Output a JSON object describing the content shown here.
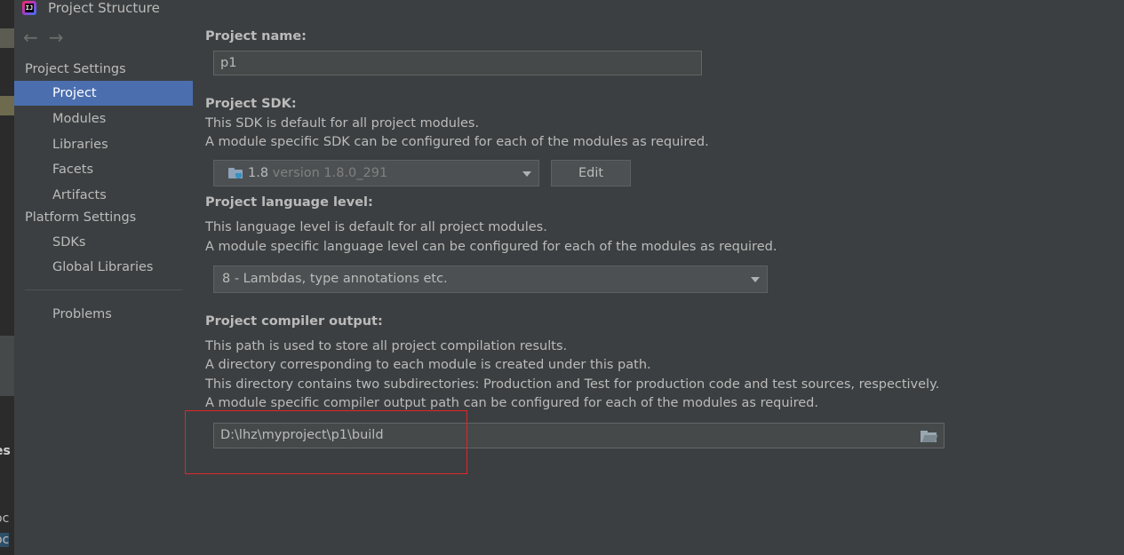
{
  "window": {
    "title": "Project Structure"
  },
  "background_fragments": [
    "es",
    "oc",
    "oc"
  ],
  "navigation": {
    "back": "←",
    "forward": "→"
  },
  "sidebar": {
    "project_settings_header": "Project Settings",
    "project_settings_items": [
      {
        "label": "Project",
        "selected": true
      },
      {
        "label": "Modules"
      },
      {
        "label": "Libraries"
      },
      {
        "label": "Facets"
      },
      {
        "label": "Artifacts"
      }
    ],
    "platform_settings_header": "Platform Settings",
    "platform_settings_items": [
      {
        "label": "SDKs"
      },
      {
        "label": "Global Libraries"
      }
    ],
    "problems_label": "Problems"
  },
  "project_name": {
    "label": "Project name:",
    "value": "p1"
  },
  "project_sdk": {
    "label": "Project SDK:",
    "desc_line1": "This SDK is default for all project modules.",
    "desc_line2": "A module specific SDK can be configured for each of the modules as required.",
    "selected_name": "1.8",
    "selected_version": "version 1.8.0_291",
    "edit_label": "Edit"
  },
  "language_level": {
    "label": "Project language level:",
    "desc_line1": "This language level is default for all project modules.",
    "desc_line2": "A module specific language level can be configured for each of the modules as required.",
    "selected": "8 - Lambdas, type annotations etc."
  },
  "compiler_output": {
    "label": "Project compiler output:",
    "desc_line1": "This path is used to store all project compilation results.",
    "desc_line2": "A directory corresponding to each module is created under this path.",
    "desc_line3": "This directory contains two subdirectories: Production and Test for production code and test sources, respectively.",
    "desc_line4": "A module specific compiler output path can be configured for each of the modules as required.",
    "path": "D:\\lhz\\myproject\\p1\\build"
  },
  "colors": {
    "background": "#3c3f41",
    "selection": "#4b6eaf",
    "highlight_box": "#e0262a"
  }
}
